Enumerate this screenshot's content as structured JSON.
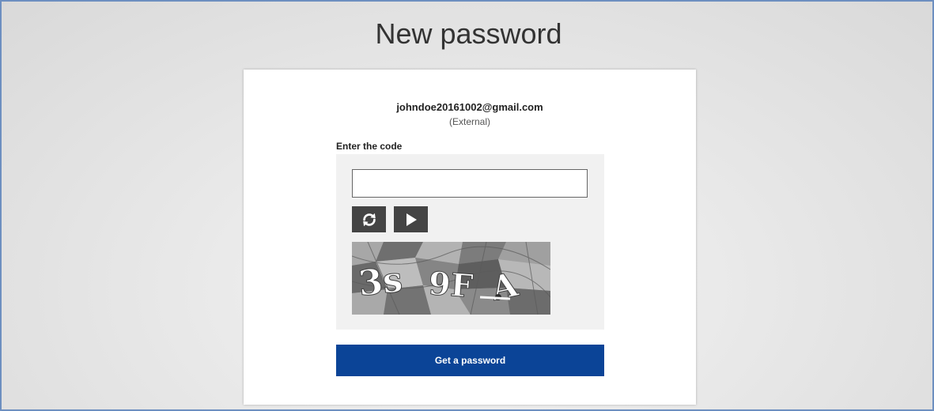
{
  "page": {
    "title": "New password"
  },
  "account": {
    "email": "johndoe20161002@gmail.com",
    "type": "(External)"
  },
  "form": {
    "code_label": "Enter the code",
    "code_input_value": "",
    "code_input_placeholder": "",
    "refresh_icon": "refresh-icon",
    "audio_icon": "play-icon",
    "submit_label": "Get a password"
  },
  "colors": {
    "submit_button": "#0b4497",
    "control_buttons": "#444444",
    "page_border": "#6d8fc0"
  }
}
